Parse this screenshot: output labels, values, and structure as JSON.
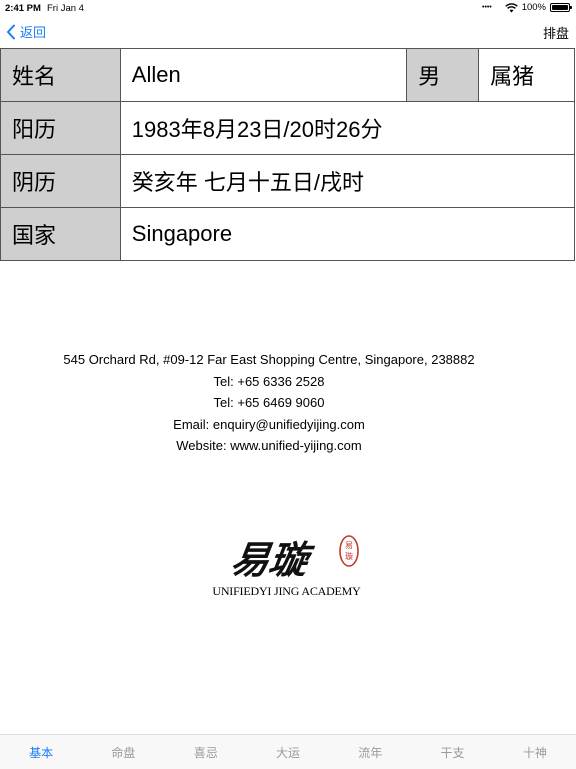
{
  "status_bar": {
    "time": "2:41 PM",
    "date": "Fri Jan 4",
    "battery": "100%",
    "battery_level": 1.0
  },
  "nav": {
    "back_label": "返回",
    "right_button": "排盘"
  },
  "info": {
    "name_label": "姓名",
    "name_value": "Allen",
    "gender": "男",
    "zodiac": "属猪",
    "solar_label": "阳历",
    "solar_value": "1983年8月23日/20时26分",
    "lunar_label": "阴历",
    "lunar_value": "癸亥年 七月十五日/戌时",
    "country_label": "国家",
    "country_value": "Singapore"
  },
  "contact": {
    "address": "545 Orchard Rd, #09-12 Far East Shopping Centre, Singapore, 238882",
    "tel1": "Tel: +65 6336 2528",
    "tel2": "Tel: +65 6469 9060",
    "email": "Email: enquiry@unifiedyijing.com",
    "website": "Website: www.unified-yijing.com"
  },
  "logo": {
    "text": "UNIFIEDYI JING ACADEMY",
    "calligraphy": "易璇",
    "seal": "易璇"
  },
  "tabs": [
    "基本",
    "命盘",
    "喜忌",
    "大运",
    "流年",
    "干支",
    "十神"
  ],
  "active_tab": "基本",
  "colors": {
    "accent": "#1a7cf5",
    "header_cell_bg": "#cfcfcf",
    "seal_red": "#c0392b"
  },
  "icons": {
    "back": "chevron-left-icon",
    "wifi": "wifi-icon",
    "battery": "battery-icon"
  }
}
